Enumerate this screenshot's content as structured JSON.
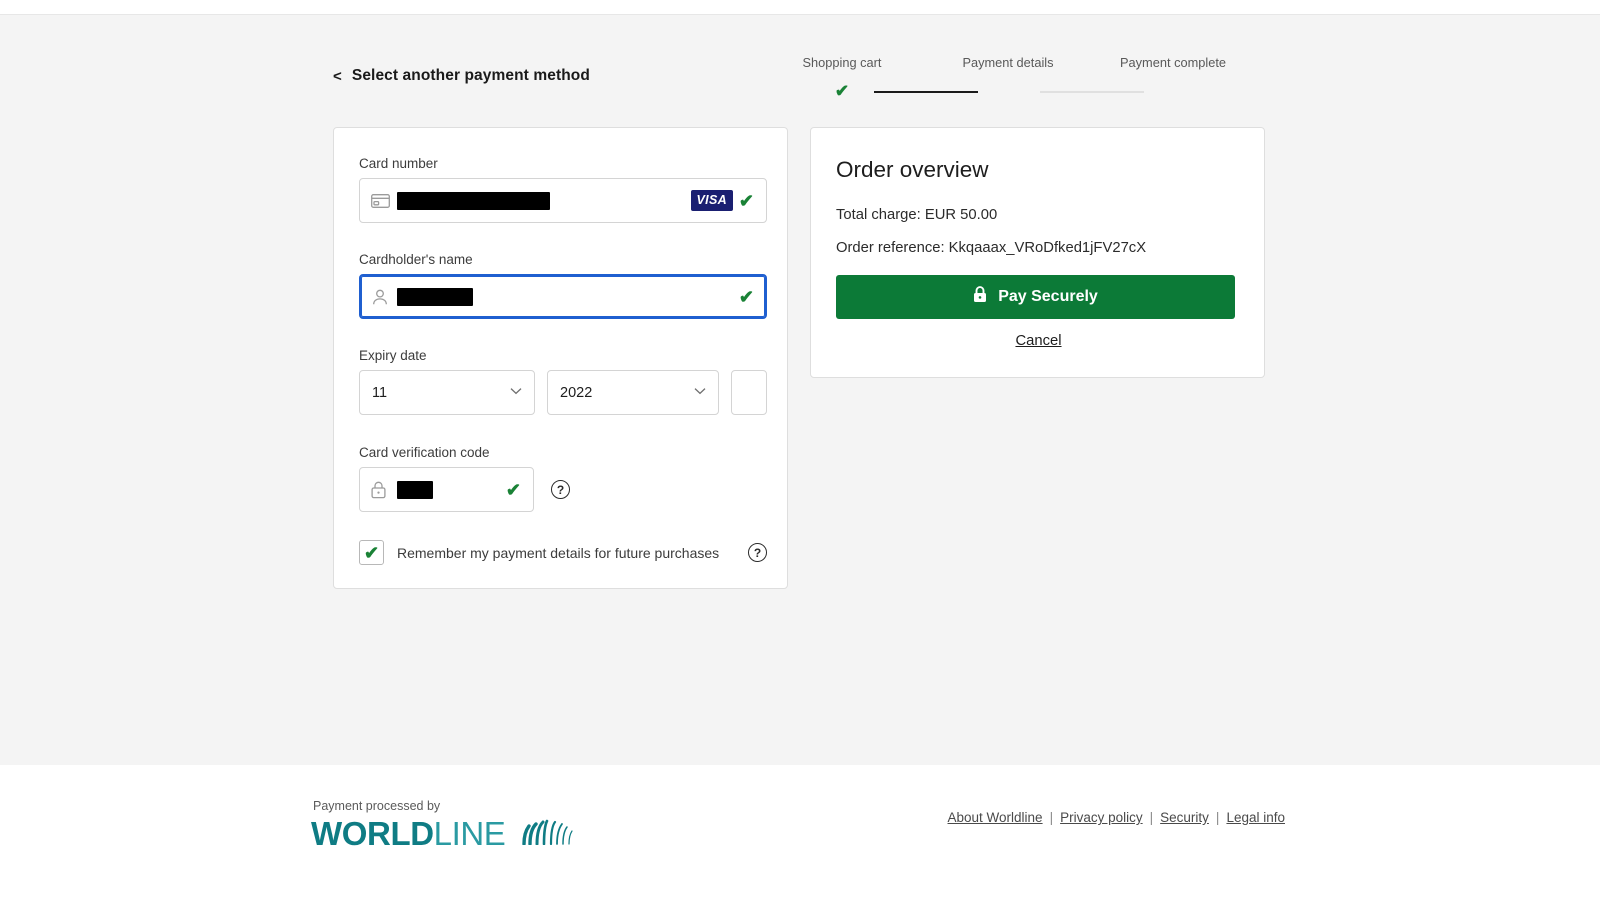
{
  "header": {
    "back_label": "Select another payment method",
    "back_chevron": "<"
  },
  "stepper": {
    "steps": [
      {
        "label": "Shopping cart",
        "state": "completed",
        "icon": "check-icon"
      },
      {
        "label": "Payment details",
        "state": "active",
        "icon": "dot-icon"
      },
      {
        "label": "Payment complete",
        "state": "upcoming",
        "icon": "dot-icon"
      }
    ]
  },
  "form": {
    "card_number": {
      "label": "Card number",
      "value": "",
      "redacted": true,
      "left_icon": "credit-card-icon",
      "brand": "VISA",
      "valid_icon": "check-icon"
    },
    "cardholder_name": {
      "label": "Cardholder's name",
      "value": "",
      "redacted": true,
      "focused": true,
      "left_icon": "person-icon",
      "valid_icon": "check-icon"
    },
    "expiry": {
      "label": "Expiry date",
      "month_value": "11",
      "year_value": "2022",
      "chevron": "chevron-down-icon"
    },
    "cvc": {
      "label": "Card verification code",
      "value": "",
      "redacted": true,
      "left_icon": "lock-icon",
      "valid_icon": "check-icon",
      "help_icon": "question-mark-icon",
      "help_glyph": "?"
    },
    "remember": {
      "label": "Remember my payment details for future purchases",
      "checked": true,
      "check_glyph": "✔",
      "help_glyph": "?"
    }
  },
  "order": {
    "title": "Order overview",
    "total_label": "Total charge:",
    "total_value": "EUR 50.00",
    "total_line": "Total charge:  EUR 50.00",
    "reference_label": "Order reference:",
    "reference_value": "Kkqaaax_VRoDfked1jFV27cX",
    "reference_line": "Order reference: Kkqaaax_VRoDfked1jFV27cX",
    "pay_button": "Pay Securely",
    "pay_button_icon": "lock-icon",
    "cancel_link": "Cancel"
  },
  "footer": {
    "processed_by": "Payment processed by",
    "logo_bold": "WORLD",
    "logo_light": "LINE",
    "logo_mark": "worldline-fan-icon",
    "links": [
      {
        "label": "About Worldline"
      },
      {
        "label": "Privacy policy"
      },
      {
        "label": "Security"
      },
      {
        "label": "Legal info"
      }
    ],
    "separator": "|"
  },
  "colors": {
    "brand_teal": "#0f7c84",
    "pay_green": "#0c7a37",
    "valid_green": "#1a8236",
    "focus_blue": "#1f5fd0",
    "visa_navy": "#1a1f71",
    "stage_bg": "#f4f4f4"
  }
}
